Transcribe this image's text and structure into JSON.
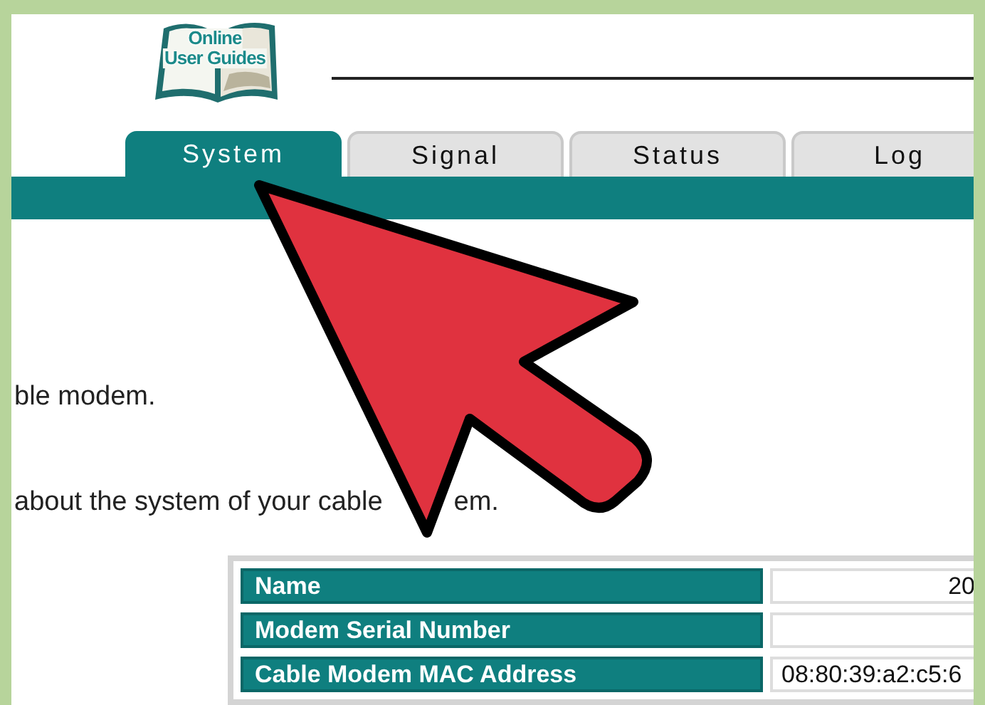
{
  "logo": {
    "line_1": "Online",
    "line_2": "User Guides"
  },
  "tabs": [
    {
      "label": "System",
      "selected": true
    },
    {
      "label": "Signal",
      "selected": false
    },
    {
      "label": "Status",
      "selected": false
    },
    {
      "label": "Log",
      "selected": false
    }
  ],
  "paragraphs": [
    [
      "ble modem."
    ],
    [
      "about the system of your cable",
      "em."
    ]
  ],
  "table": {
    "rows": [
      {
        "label": "Name",
        "value": "20",
        "kind": "end"
      },
      {
        "label": "Modem Serial Number"
      },
      {
        "label": "Cable Modem MAC Address",
        "value": "08:80:39:a2:c5:6",
        "kind": "start"
      }
    ]
  }
}
